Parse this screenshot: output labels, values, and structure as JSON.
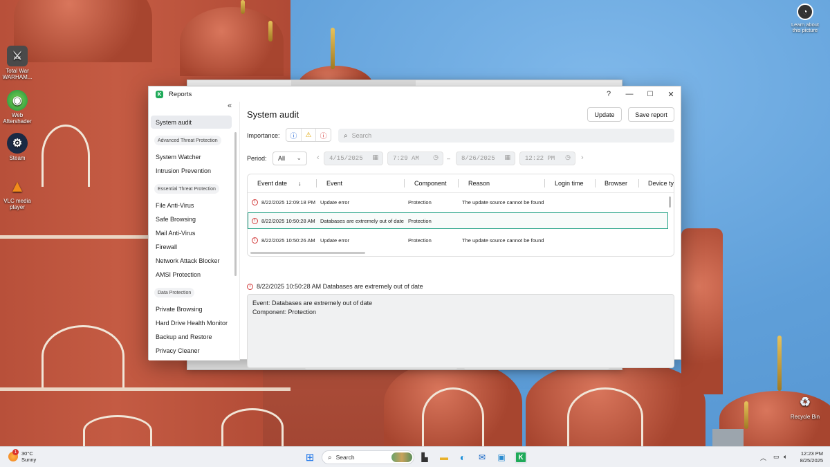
{
  "desktop": {
    "icons": [
      {
        "label": "Total War WARHAM...",
        "icon": "total-war-icon"
      },
      {
        "label": "Web Aftershader",
        "icon": "web-icon"
      },
      {
        "label": "Steam",
        "icon": "steam-icon"
      },
      {
        "label": "VLC media player",
        "icon": "vlc-icon"
      }
    ],
    "learn_label": "Learn about this picture",
    "recycle_label": "Recycle Bin"
  },
  "window": {
    "title": "Reports",
    "help": "?",
    "minimize": "—",
    "maximize": "☐",
    "close": "✕",
    "collapse": "«"
  },
  "sidebar": {
    "items": [
      {
        "label": "System audit",
        "active": true
      },
      {
        "group": "Advanced Threat Protection"
      },
      {
        "label": "System Watcher"
      },
      {
        "label": "Intrusion Prevention"
      },
      {
        "group": "Essential Threat Protection"
      },
      {
        "label": "File Anti-Virus"
      },
      {
        "label": "Safe Browsing"
      },
      {
        "label": "Mail Anti-Virus"
      },
      {
        "label": "Firewall"
      },
      {
        "label": "Network Attack Blocker"
      },
      {
        "label": "AMSI Protection"
      },
      {
        "group": "Data Protection"
      },
      {
        "label": "Private Browsing"
      },
      {
        "label": "Hard Drive Health Monitor"
      },
      {
        "label": "Backup and Restore"
      },
      {
        "label": "Privacy Cleaner"
      }
    ]
  },
  "main": {
    "title": "System audit",
    "update_label": "Update",
    "save_label": "Save report",
    "importance_label": "Importance:",
    "importance": [
      "info-icon",
      "warning-icon",
      "error-icon"
    ],
    "search_placeholder": "Search",
    "period_label": "Period:",
    "period_value": "All",
    "date_from": "4/15/2025",
    "time_from": "7:29 AM",
    "dash": "–",
    "date_to": "8/26/2025",
    "time_to": "12:22 PM",
    "columns": [
      "Event date",
      "Event",
      "Component",
      "Reason",
      "Login time",
      "Browser",
      "Device ty"
    ],
    "sort_indicator": "↓",
    "rows": [
      {
        "date": "8/22/2025 12:09:18 PM",
        "event": "Update error",
        "component": "Protection",
        "reason": "The update source cannot be found",
        "selected": false
      },
      {
        "date": "8/22/2025 10:50:28 AM",
        "event": "Databases are extremely out of date",
        "component": "Protection",
        "reason": "",
        "selected": true
      },
      {
        "date": "8/22/2025 10:50:26 AM",
        "event": "Update error",
        "component": "Protection",
        "reason": "The update source cannot be found",
        "selected": false
      }
    ],
    "detail_heading": "8/22/2025 10:50:28 AM Databases are extremely out of date",
    "detail_lines": [
      "Event: Databases are extremely out of date",
      "Component: Protection"
    ]
  },
  "taskbar": {
    "temperature": "30°C",
    "condition": "Sunny",
    "weather_badge": "1",
    "search_label": "Search",
    "time": "12:23 PM",
    "date": "8/25/2025",
    "apps": [
      "windows-start-icon",
      "task-view-icon",
      "file-explorer-icon",
      "edge-icon",
      "outlook-icon",
      "remote-desktop-icon",
      "kaspersky-icon"
    ]
  },
  "colors": {
    "accent": "#1d9f82",
    "error": "#d23b3b",
    "info": "#2b6cd6",
    "warning": "#e0a500",
    "kaspersky": "#1faa59"
  }
}
